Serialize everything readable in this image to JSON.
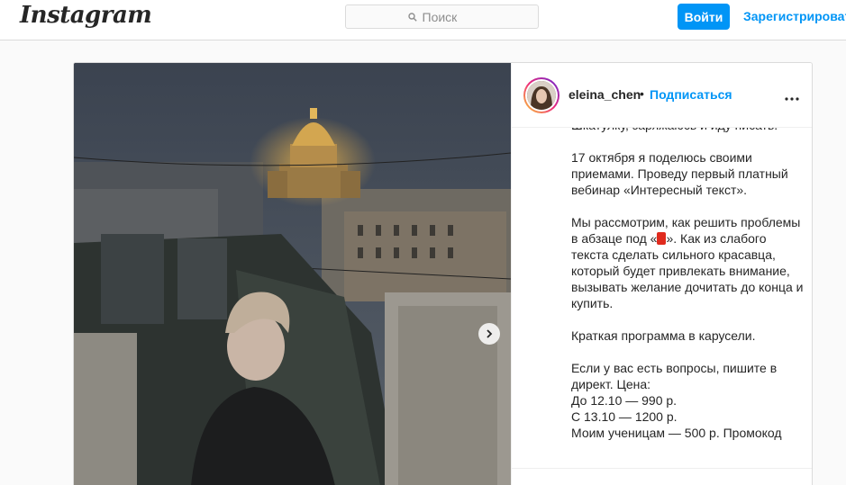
{
  "header": {
    "logo": "Instagram",
    "search_placeholder": "Поиск",
    "login_label": "Войти",
    "signup_label": "Зарегистрироваться"
  },
  "post": {
    "username": "eleina_chen",
    "separator": "•",
    "follow_label": "Подписаться",
    "more_icon": "more-horizontal-icon",
    "caption_top": "Шкатулку, заряжаюсь и иду писать.",
    "caption_p1": "17 октября я поделюсь своими приемами. Проведу первый платный вебинар «Интересный текст».",
    "caption_p2_before": "Мы рассмотрим, как решить проблемы в абзаце под «",
    "caption_p2_after": "». Как из слабого текста сделать сильного красавца, который будет привлекать внимание, вызывать желание дочитать до конца и купить.",
    "caption_p3": "Краткая программа в карусели.",
    "caption_p4": "Если у вас есть вопросы, пишите в директ. Цена:",
    "price_1": "До 12.10 — 990 р.",
    "price_2": "С 13.10 — 1200 р.",
    "price_3": "Моим ученицам — 500 р. Промокод"
  },
  "colors": {
    "accent": "#0095f6",
    "text": "#262626",
    "border": "#dbdbdb"
  }
}
